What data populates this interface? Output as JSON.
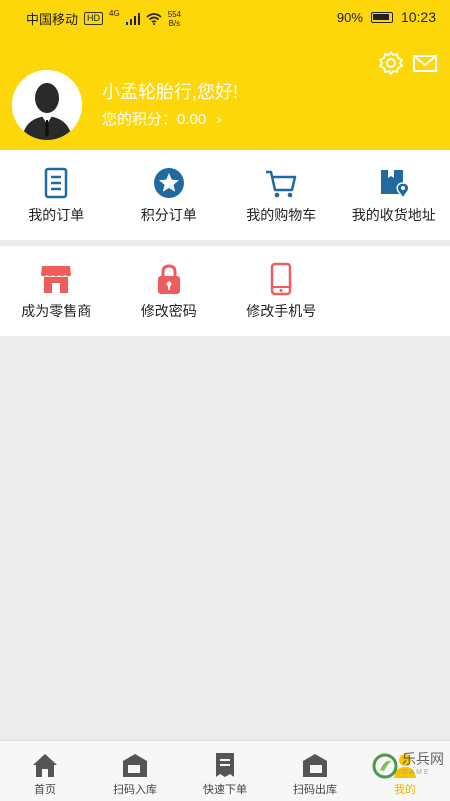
{
  "status_bar": {
    "carrier": "中国移动",
    "hd": "HD",
    "network": "4G",
    "speed": "554\nB/s",
    "battery": "90%",
    "time": "10:23"
  },
  "header": {
    "greeting": "小孟轮胎行,您好!",
    "points_label": "您的积分：0.00",
    "chevron": "›"
  },
  "grid_row1": [
    {
      "label": "我的订单",
      "icon": "order-icon"
    },
    {
      "label": "积分订单",
      "icon": "star-icon"
    },
    {
      "label": "我的购物车",
      "icon": "cart-icon"
    },
    {
      "label": "我的收货地址",
      "icon": "address-icon"
    }
  ],
  "grid_row2": [
    {
      "label": "成为零售商",
      "icon": "store-icon"
    },
    {
      "label": "修改密码",
      "icon": "lock-icon"
    },
    {
      "label": "修改手机号",
      "icon": "phone-icon"
    }
  ],
  "tabbar": [
    {
      "label": "首页",
      "icon": "home-icon"
    },
    {
      "label": "扫码入库",
      "icon": "scan-in-icon"
    },
    {
      "label": "快速下单",
      "icon": "quick-order-icon"
    },
    {
      "label": "扫码出库",
      "icon": "scan-out-icon"
    },
    {
      "label": "我的",
      "icon": "user-icon"
    }
  ],
  "watermark": {
    "text": "乐兵网",
    "sub": "GAME"
  },
  "colors": {
    "brand": "#fdd70a",
    "blue": "#1f6aa0",
    "red": "#ef5c5c"
  }
}
